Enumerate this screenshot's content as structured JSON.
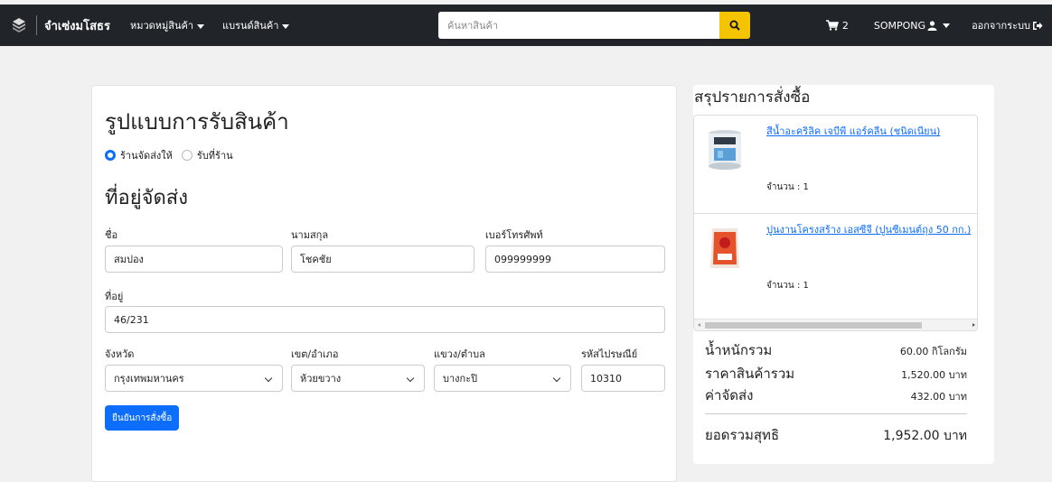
{
  "navbar": {
    "brand": "จำเซ่งมโสธร",
    "menu_categories": "หมวดหมู่สินค้า",
    "menu_brands": "แบรนด์สินค้า",
    "search_placeholder": "ค้นหาสินค้า",
    "cart_count": "2",
    "username": "SOMPONG",
    "logout": "ออกจากระบบ"
  },
  "delivery": {
    "title": "รูปแบบการรับสินค้า",
    "options": [
      {
        "label": "ร้านจัดส่งให้",
        "selected": true
      },
      {
        "label": "รับที่ร้าน",
        "selected": false
      }
    ]
  },
  "address": {
    "title": "ที่อยู่จัดส่ง",
    "first_name_label": "ชื่อ",
    "first_name_value": "สมปอง",
    "last_name_label": "นามสกุล",
    "last_name_value": "โชคชัย",
    "phone_label": "เบอร์โทรศัพท์",
    "phone_value": "099999999",
    "address_label": "ที่อยู่",
    "address_value": "46/231",
    "province_label": "จังหวัด",
    "province_value": "กรุงเทพมหานคร",
    "district_label": "เขต/อำเภอ",
    "district_value": "ห้วยขวาง",
    "subdistrict_label": "แขวง/ตำบล",
    "subdistrict_value": "บางกะปิ",
    "postcode_label": "รหัสไปรษณีย์",
    "postcode_value": "10310",
    "confirm_button": "ยืนยันการสั่งซื้อ"
  },
  "summary": {
    "title": "สรุปรายการสั่งซื้อ",
    "items": [
      {
        "name": "สีน้ำอะคริลิค เจบีพี แอร์คลีน (ชนิดเนียน)",
        "qty": "จำนวน : 1",
        "thumb": "paint-bucket-icon",
        "color": "#3f8fd0"
      },
      {
        "name": "ปูนงานโครงสร้าง เอสซีจี (ปูนซีเมนต์ถุง 50 กก.)",
        "qty": "จำนวน : 1",
        "thumb": "cement-bag-icon",
        "color": "#e8532a"
      }
    ],
    "weight_label": "น้ำหนักรวม",
    "weight_value": "60.00 กิโลกรัม",
    "price_label": "ราคาสินค้ารวม",
    "price_value": "1,520.00 บาท",
    "shipping_label": "ค่าจัดส่ง",
    "shipping_value": "432.00 บาท",
    "total_label": "ยอดรวมสุทธิ",
    "total_value": "1,952.00 บาท"
  },
  "colors": {
    "navbar": "#212529",
    "primary": "#0d6efd",
    "search_button": "#f5c400"
  }
}
